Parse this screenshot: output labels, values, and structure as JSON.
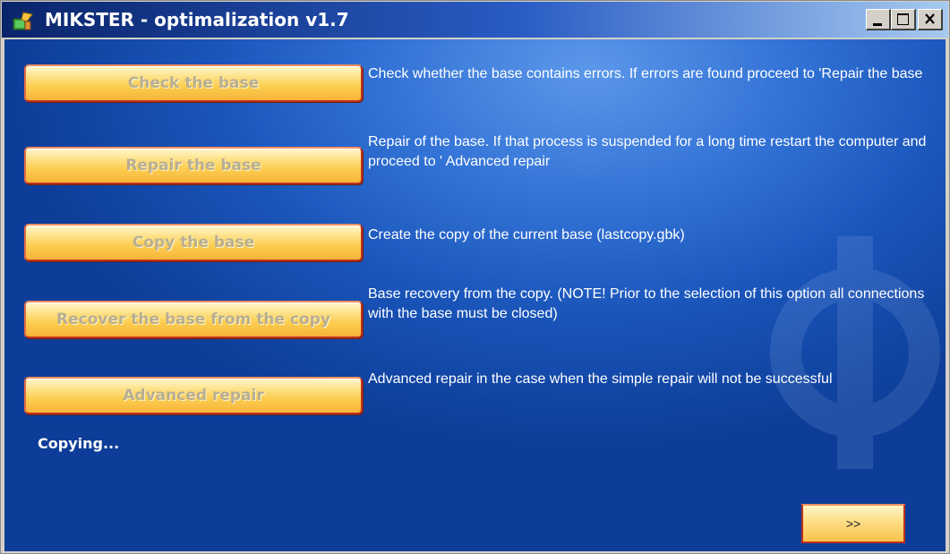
{
  "window": {
    "title": "MIKSTER - optimalization v1.7",
    "controls": {
      "minimize": "_",
      "maximize": "□",
      "close": "X"
    }
  },
  "actions": [
    {
      "label": "Check the base",
      "description": "Check whether the base contains errors. If errors are found proceed to 'Repair the base"
    },
    {
      "label": "Repair the base",
      "description": "Repair of the base. If that process is suspended for a long time restart the computer and proceed to ' Advanced repair"
    },
    {
      "label": "Copy the base",
      "description": "Create the copy of the current base (lastcopy.gbk)"
    },
    {
      "label": "Recover the base from the copy",
      "description": "Base recovery from the copy. (NOTE! Prior to the selection of this option all connections with the base must be closed)"
    },
    {
      "label": "Advanced repair",
      "description": "Advanced repair in the case when the simple repair will not be successful"
    }
  ],
  "status": {
    "text": "Copying..."
  },
  "next_button": {
    "label": ">>"
  },
  "colors": {
    "accent": "#f6b43a",
    "button_border": "#c0301b",
    "disabled_text": "#b9ae92",
    "background": "#1a55ba"
  },
  "icons": {
    "app": "app-icon",
    "minimize": "minimize-icon",
    "maximize": "maximize-icon",
    "close": "close-icon"
  }
}
